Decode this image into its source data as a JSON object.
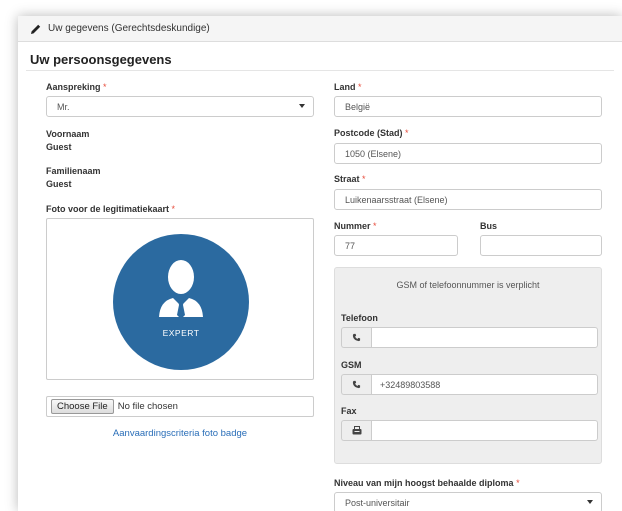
{
  "panel": {
    "heading": "Uw gegevens (Gerechtsdeskundige)"
  },
  "section": {
    "title": "Uw persoonsgegevens"
  },
  "left": {
    "aanspreking_label": "Aanspreking",
    "aanspreking_value": "Mr.",
    "voornaam_label": "Voornaam",
    "voornaam_value": "Guest",
    "familienaam_label": "Familienaam",
    "familienaam_value": "Guest",
    "foto_label": "Foto voor de legitimatiekaart",
    "avatar_caption": "EXPERT",
    "file_button": "Choose File",
    "file_status": "No file chosen",
    "criteria_link": "Aanvaardingscriteria foto badge"
  },
  "right": {
    "land_label": "Land",
    "land_value": "België",
    "postcode_label": "Postcode (Stad)",
    "postcode_value": "1050 (Elsene)",
    "straat_label": "Straat",
    "straat_value": "Luikenaarsstraat (Elsene)",
    "nummer_label": "Nummer",
    "nummer_value": "77",
    "bus_label": "Bus",
    "bus_value": "",
    "phone_note": "GSM of telefoonnummer is verplicht",
    "telefoon_label": "Telefoon",
    "telefoon_value": "",
    "gsm_label": "GSM",
    "gsm_value": "+32489803588",
    "fax_label": "Fax",
    "fax_value": "",
    "diploma_label": "Niveau van mijn hoogst behaalde diploma",
    "diploma_value": "Post-universitair"
  },
  "required_marker": "*",
  "colors": {
    "avatar_bg": "#2b6aa0",
    "required": "#e74c3c",
    "link": "#2a6eb8"
  },
  "icons": [
    "pencil-icon",
    "caret-down-icon",
    "expert-avatar-icon",
    "phone-icon",
    "fax-icon"
  ]
}
